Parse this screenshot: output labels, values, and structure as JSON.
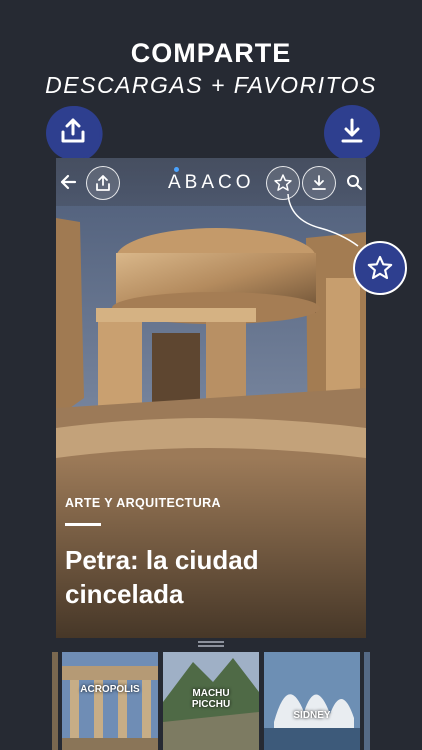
{
  "promo": {
    "headline": "COMPARTE",
    "subline": "DESCARGAS + FAVORITOS"
  },
  "app": {
    "brand": "ABACO",
    "toolbar": {
      "back_icon": "arrow-left-icon",
      "share_icon": "share-icon",
      "favorite_icon": "star-icon",
      "download_icon": "download-icon",
      "search_icon": "search-icon"
    }
  },
  "article": {
    "category": "ARTE Y ARQUITECTURA",
    "title_line1": "Petra: la ciudad",
    "title_line2": "cincelada"
  },
  "thumbnails": [
    {
      "label": "ACROPOLIS"
    },
    {
      "label_line1": "MACHU",
      "label_line2": "PICCHU"
    },
    {
      "label": "SIDNEY"
    }
  ],
  "colors": {
    "background": "#262a33",
    "bubble": "#2e3f8f",
    "text": "#ffffff"
  }
}
